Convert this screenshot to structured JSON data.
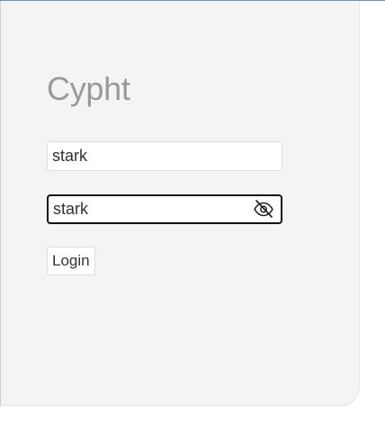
{
  "app": {
    "title": "Cypht"
  },
  "form": {
    "username_value": "stark",
    "password_value": "stark",
    "password_visible": true,
    "login_label": "Login"
  },
  "icons": {
    "visibility_toggle": "eye-slash-icon"
  },
  "colors": {
    "panel_background": "#f4f4f4",
    "title_text": "#999999",
    "active_field_border": "#111111"
  }
}
